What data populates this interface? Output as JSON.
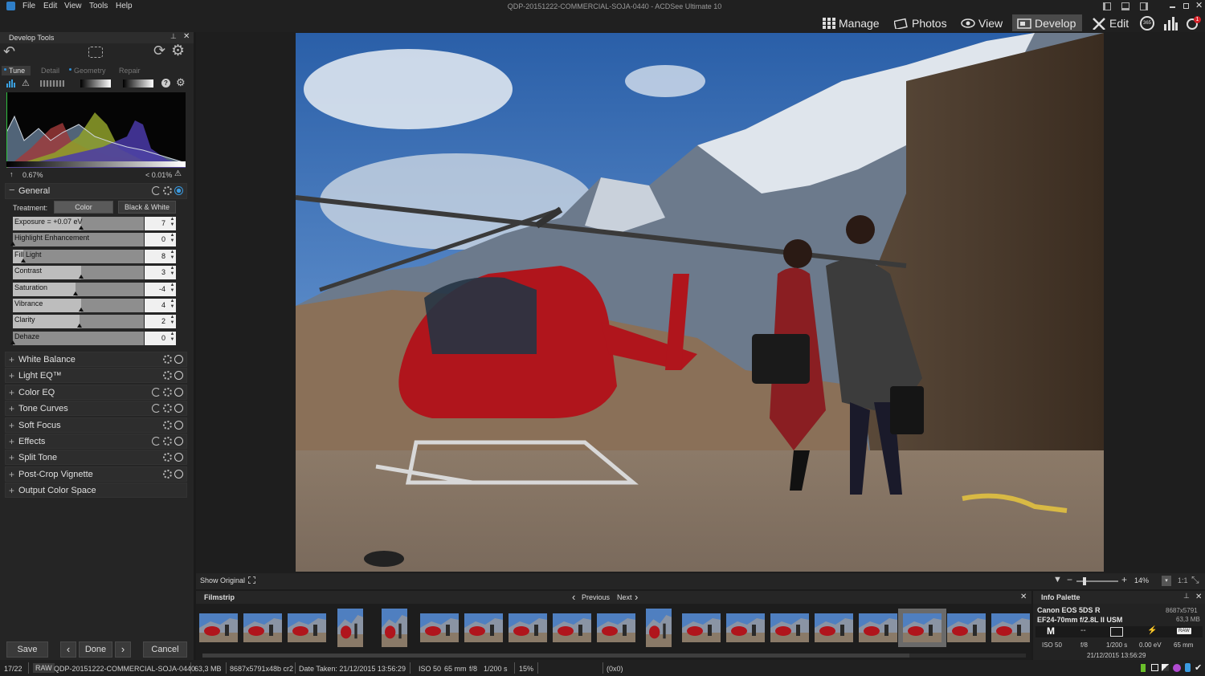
{
  "window": {
    "title": "QDP-20151222-COMMERCIAL-SOJA-0440 - ACDSee Ultimate 10"
  },
  "menu": [
    "File",
    "Edit",
    "View",
    "Tools",
    "Help"
  ],
  "modes": {
    "manage": "Manage",
    "photos": "Photos",
    "view": "View",
    "develop": "Develop",
    "edit": "Edit"
  },
  "develop_tools": {
    "title": "Develop Tools",
    "tabs": [
      "Tune",
      "Detail",
      "Geometry",
      "Repair"
    ],
    "histogram": {
      "clip_left": "0.67%",
      "clip_right": "< 0.01%"
    },
    "general": {
      "label": "General",
      "treatment_label": "Treatment:",
      "treatment_color": "Color",
      "treatment_bw": "Black & White",
      "sliders": [
        {
          "name": "Exposure = +0.07 eV",
          "value": "7",
          "level": 0.52
        },
        {
          "name": "Highlight Enhancement",
          "value": "0",
          "level": 0.0
        },
        {
          "name": "Fill Light",
          "value": "8",
          "level": 0.08
        },
        {
          "name": "Contrast",
          "value": "3",
          "level": 0.52
        },
        {
          "name": "Saturation",
          "value": "-4",
          "level": 0.48
        },
        {
          "name": "Vibrance",
          "value": "4",
          "level": 0.52
        },
        {
          "name": "Clarity",
          "value": "2",
          "level": 0.51
        },
        {
          "name": "Dehaze",
          "value": "0",
          "level": 0.0
        }
      ]
    },
    "sections": [
      "White Balance",
      "Light EQ™",
      "Color EQ",
      "Tone Curves",
      "Soft Focus",
      "Effects",
      "Split Tone",
      "Post-Crop Vignette",
      "Output Color Space"
    ],
    "save": "Save",
    "done": "Done",
    "cancel": "Cancel"
  },
  "viewer": {
    "show_original": "Show Original",
    "zoom": "14%",
    "one_to_one": "1:1"
  },
  "filmstrip": {
    "title": "Filmstrip",
    "previous": "Previous",
    "next": "Next"
  },
  "info_palette": {
    "title": "Info Palette",
    "camera": "Canon EOS 5DS R",
    "lens": "EF24-70mm f/2.8L II USM",
    "dimensions": "8687x5791",
    "size": "63,3 MB",
    "mode": "M",
    "metering": "--",
    "flash": "⚡",
    "format": "RAW",
    "iso": "ISO 50",
    "aperture": "f/8",
    "shutter": "1/200 s",
    "ev": "0.00 eV",
    "focal": "65 mm",
    "date": "21/12/2015 13:56:29"
  },
  "status": {
    "index": "17/22",
    "format": "RAW",
    "filename": "QDP-20151222-COMMERCIAL-SOJA-0440",
    "filesize": "63,3 MB",
    "dimensions": "8687x5791x48b cr2",
    "date_taken": "Date Taken: 21/12/2015 13:56:29",
    "iso": "ISO 50",
    "focal": "65 mm",
    "aperture": "f/8",
    "shutter": "1/200 s",
    "zoom": "15%",
    "coords": "(0x0)"
  },
  "colors": {
    "accent_blue": "#2f8fd8",
    "panel": "#252525",
    "heli_red": "#b0151c"
  }
}
